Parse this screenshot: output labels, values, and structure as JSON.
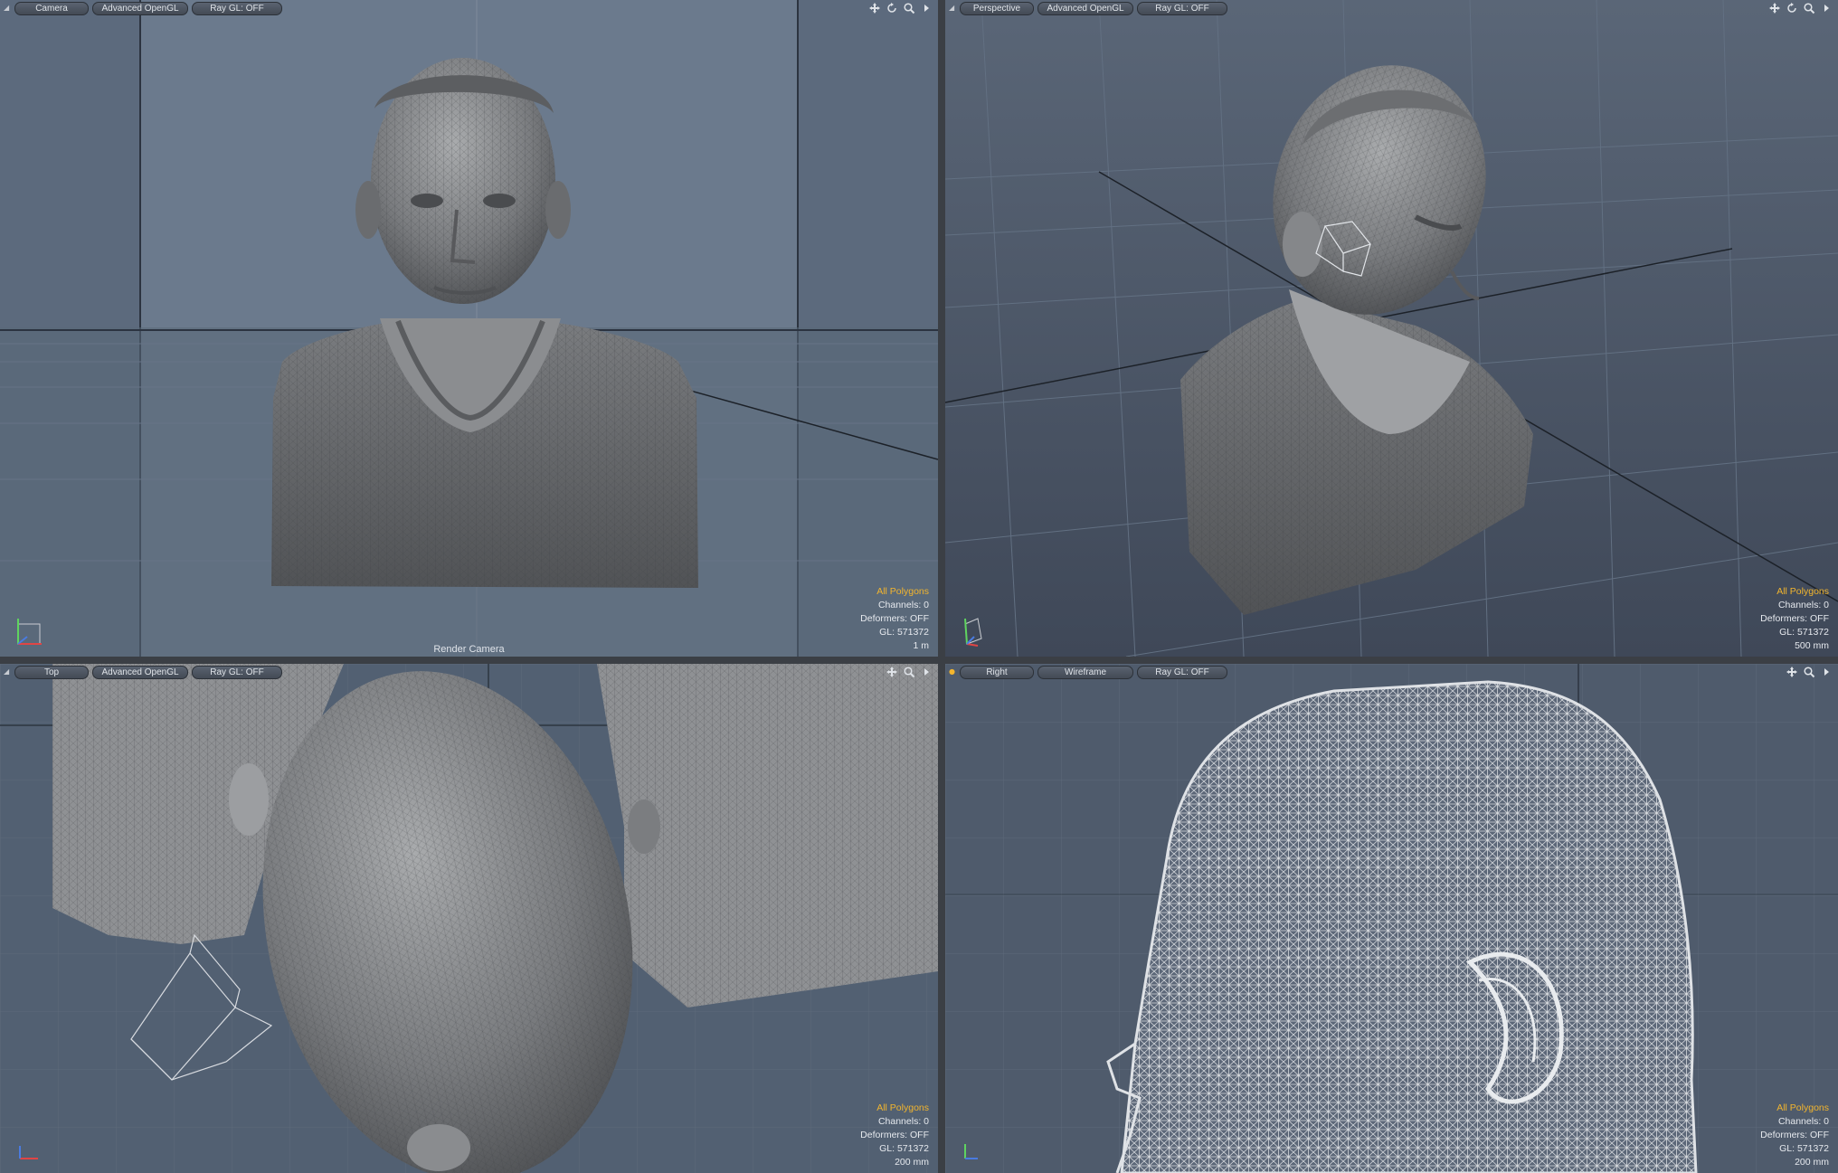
{
  "viewports": {
    "camera": {
      "view": "Camera",
      "shading": "Advanced OpenGL",
      "raygl": "Ray GL: OFF",
      "bottom_label": "Render Camera",
      "info": {
        "selection": "All Polygons",
        "channels": "Channels: 0",
        "deformers": "Deformers: OFF",
        "gl": "GL: 571372",
        "scale": "1 m"
      }
    },
    "perspective": {
      "view": "Perspective",
      "shading": "Advanced OpenGL",
      "raygl": "Ray GL: OFF",
      "info": {
        "selection": "All Polygons",
        "channels": "Channels: 0",
        "deformers": "Deformers: OFF",
        "gl": "GL: 571372",
        "scale": "500 mm"
      }
    },
    "top": {
      "view": "Top",
      "shading": "Advanced OpenGL",
      "raygl": "Ray GL: OFF",
      "info": {
        "selection": "All Polygons",
        "channels": "Channels: 0",
        "deformers": "Deformers: OFF",
        "gl": "GL: 571372",
        "scale": "200 mm"
      }
    },
    "right": {
      "view": "Right",
      "shading": "Wireframe",
      "raygl": "Ray GL: OFF",
      "info": {
        "selection": "All Polygons",
        "channels": "Channels: 0",
        "deformers": "Deformers: OFF",
        "gl": "GL: 571372",
        "scale": "200 mm"
      }
    }
  },
  "nav_icons": [
    "move-icon",
    "rotate-icon",
    "zoom-icon",
    "menu-arrow-icon"
  ],
  "colors": {
    "selection_highlight": "#f2b52e",
    "text": "#e6e9ee",
    "mesh": "#8a8d91",
    "wireframe": "#c9ccd1"
  }
}
